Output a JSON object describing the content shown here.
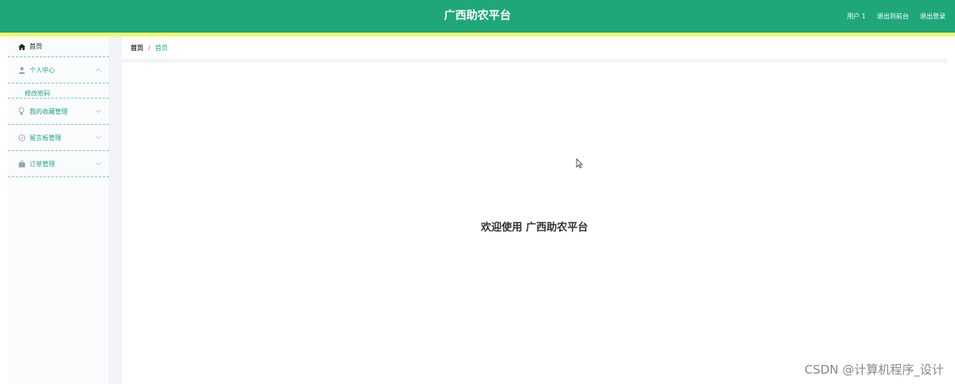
{
  "header": {
    "title": "广西助农平台",
    "user_label": "用户 1",
    "back_to_frontend": "退出到前台",
    "logout": "退出登录"
  },
  "sidebar": {
    "items": [
      {
        "label": "首页",
        "icon": "home-icon"
      },
      {
        "label": "个人中心",
        "icon": "user-icon",
        "expanded": true
      },
      {
        "label": "我的收藏管理",
        "icon": "bulb-icon"
      },
      {
        "label": "留言板管理",
        "icon": "compass-icon"
      },
      {
        "label": "订单管理",
        "icon": "briefcase-icon"
      }
    ],
    "sub_items": {
      "personal_center": [
        "修改密码"
      ]
    }
  },
  "breadcrumb": {
    "home": "首页",
    "separator": "/",
    "current": "首页"
  },
  "main": {
    "welcome": "欢迎使用 广西助农平台"
  },
  "watermark": "CSDN @计算机程序_设计",
  "colors": {
    "primary": "#1fa77a",
    "accent_strip": "#f4f86c",
    "separator": "#e54d4d"
  }
}
